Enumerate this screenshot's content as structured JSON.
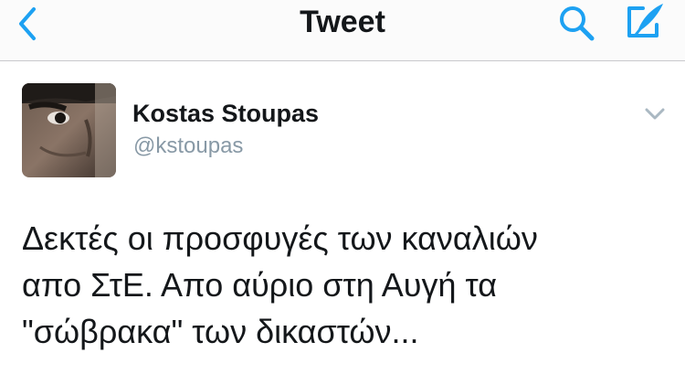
{
  "nav": {
    "title": "Tweet",
    "back_icon": "chevron-left-icon",
    "search_icon": "search-icon",
    "compose_icon": "compose-icon",
    "accent": "#1da1f2"
  },
  "tweet": {
    "author": {
      "name": "Kostas Stoupas",
      "handle": "@kstoupas"
    },
    "text_lines": [
      "Δεκτές οι προσφυγές των καναλιών",
      "απο ΣτΕ. Απο αύριο στη Αυγή τα",
      "\"σώβρακα\" των δικαστών..."
    ],
    "caret_icon": "chevron-down-icon"
  }
}
